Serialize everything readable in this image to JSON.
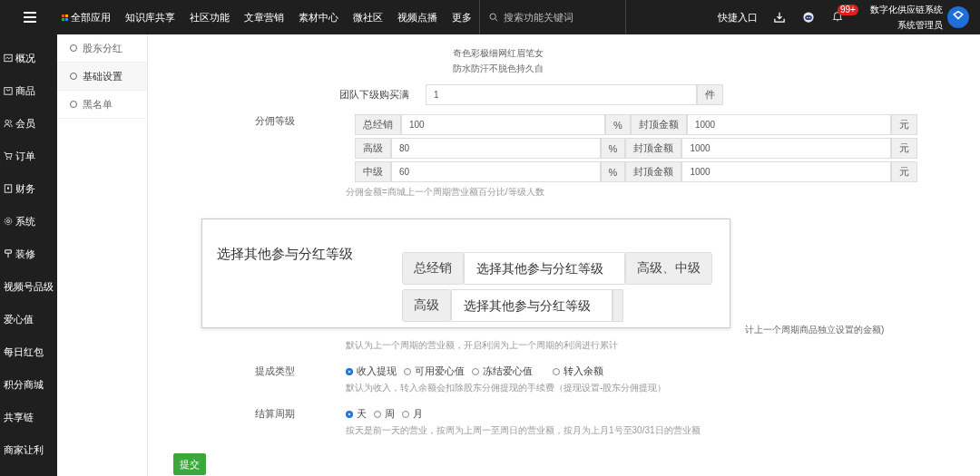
{
  "topbar": {
    "nav": [
      {
        "label": "全部应用",
        "kind": "apps"
      },
      {
        "label": "知识库共享",
        "kind": "text"
      },
      {
        "label": "社区功能",
        "kind": "text"
      },
      {
        "label": "文章营销",
        "kind": "text"
      },
      {
        "label": "素材中心",
        "kind": "text"
      },
      {
        "label": "微社区",
        "kind": "text"
      },
      {
        "label": "视频点播",
        "kind": "text"
      },
      {
        "label": "更多",
        "kind": "text"
      }
    ],
    "search": {
      "placeholder": "搜索功能关键词"
    },
    "shortcut": "快捷入口",
    "badge": "99+",
    "company": "数字化供应链系统",
    "role": "系统管理员"
  },
  "sidebar": {
    "items": [
      {
        "label": "概况"
      },
      {
        "label": "商品"
      },
      {
        "label": "会员"
      },
      {
        "label": "订单"
      },
      {
        "label": "财务"
      },
      {
        "label": "系统"
      },
      {
        "label": "装修"
      },
      {
        "label": "视频号品级"
      },
      {
        "label": "爱心值"
      },
      {
        "label": "每日红包"
      },
      {
        "label": "积分商城"
      },
      {
        "label": "共享链"
      },
      {
        "label": "商家让利"
      }
    ]
  },
  "subnav": [
    {
      "label": "股东分红",
      "selected": false
    },
    {
      "label": "基础设置",
      "selected": true
    },
    {
      "label": "黑名单",
      "selected": false
    }
  ],
  "top_text": [
    "奇色彩极细网红眉笔女",
    "防水防汗不脱色持久自"
  ],
  "team_purchase": {
    "label": "团队下级购买满",
    "value": "1",
    "unit": "件"
  },
  "levels": {
    "label": "分佣等级",
    "rows": [
      {
        "name": "总经销",
        "value": "100",
        "unit": "%",
        "cap_label": "封顶金额",
        "cap": "1000",
        "cap_unit": "元"
      },
      {
        "name": "高级",
        "value": "80",
        "unit": "%",
        "cap_label": "封顶金额",
        "cap": "1000",
        "cap_unit": "元"
      },
      {
        "name": "中级",
        "value": "60",
        "unit": "%",
        "cap_label": "封顶金额",
        "cap": "1000",
        "cap_unit": "元"
      }
    ],
    "hint": "分佣金额=商城上一个周期营业额百分比/等级人数"
  },
  "popup": {
    "title": "选择其他参与分红等级",
    "rows": [
      {
        "name": "总经销",
        "placeholder": "选择其他参与分红等级",
        "addon": "高级、中级"
      },
      {
        "name": "高级",
        "placeholder": "选择其他参与分红等级",
        "addon": ""
      }
    ]
  },
  "partial_row": {
    "fragment": "计上一个周期商品独立设置的金额)",
    "hint": "默认为上一个周期的营业额，开启利润为上一个周期的利润进行累计"
  },
  "radio_groups": [
    {
      "label": "提成类型",
      "options": [
        {
          "label": "收入提现",
          "selected": true
        },
        {
          "label": "可用爱心值",
          "selected": false
        },
        {
          "label": "冻结爱心值",
          "selected": false
        },
        {
          "label": "转入余额",
          "selected": false
        }
      ],
      "hint": "默认为收入，转入余额会扣除股东分佣提现的手续费（提现设置-股东分佣提现）"
    },
    {
      "label": "结算周期",
      "options": [
        {
          "label": "天",
          "selected": true
        },
        {
          "label": "周",
          "selected": false
        },
        {
          "label": "月",
          "selected": false
        }
      ],
      "hint": "按天是前一天的营业，按周为上周一至周日的营业额，按月为上月1号至30/31日的营业额"
    }
  ],
  "submit": "提交"
}
